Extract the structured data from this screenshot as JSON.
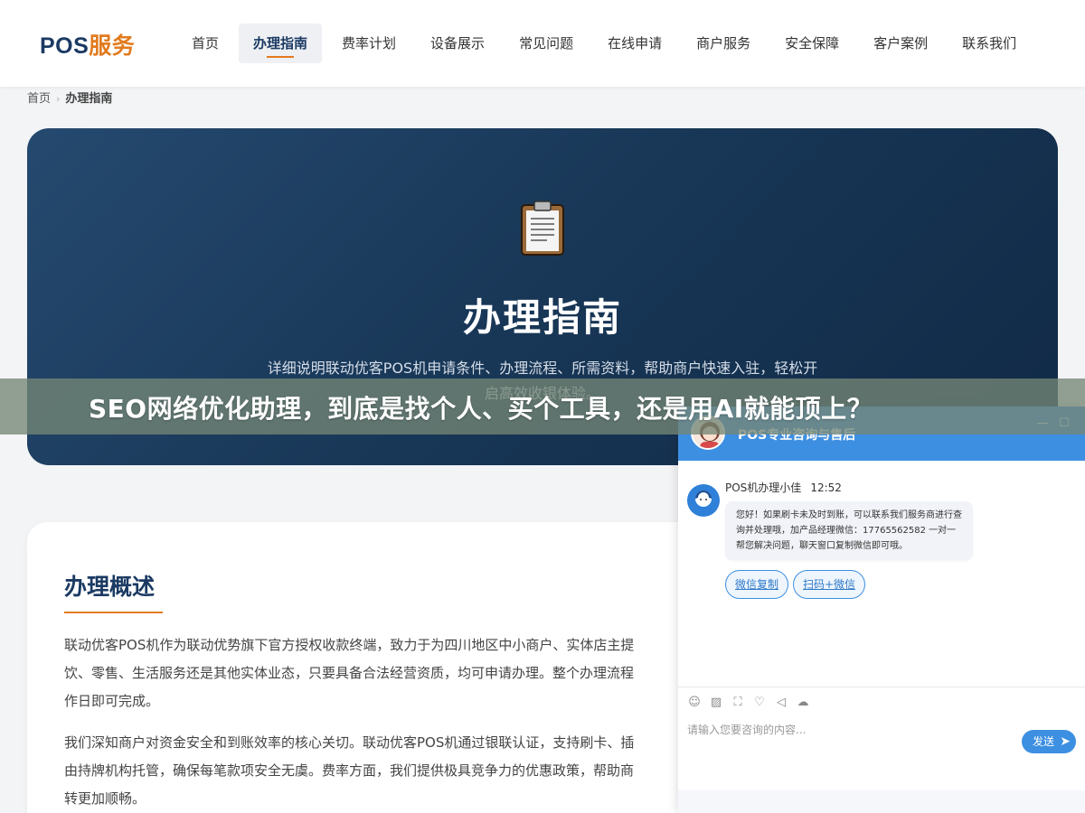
{
  "header": {
    "logo_part1": "POS",
    "logo_part2": "服务",
    "nav": [
      {
        "label": "首页",
        "active": false
      },
      {
        "label": "办理指南",
        "active": true
      },
      {
        "label": "费率计划",
        "active": false
      },
      {
        "label": "设备展示",
        "active": false
      },
      {
        "label": "常见问题",
        "active": false
      },
      {
        "label": "在线申请",
        "active": false
      },
      {
        "label": "商户服务",
        "active": false
      },
      {
        "label": "安全保障",
        "active": false
      },
      {
        "label": "客户案例",
        "active": false
      },
      {
        "label": "联系我们",
        "active": false
      }
    ]
  },
  "breadcrumb": {
    "home": "首页",
    "current": "办理指南"
  },
  "hero": {
    "icon": "clipboard-icon",
    "title": "办理指南",
    "description": "详细说明联动优客POS机申请条件、办理流程、所需资料，帮助商户快速入驻，轻松开启高效收银体验。"
  },
  "overlay_banner": {
    "text": "SEO网络优化助理，到底是找个人、买个工具，还是用AI就能顶上？"
  },
  "overview": {
    "heading": "办理概述",
    "paragraph1": "联动优客POS机作为联动优势旗下官方授权收款终端，致力于为四川地区中小商户、实体店主提\n饮、零售、生活服务还是其他实体业态，只要具备合法经营资质，均可申请办理。整个办理流程\n作日即可完成。",
    "paragraph2": "我们深知商户对资金安全和到账效率的核心关切。联动优客POS机通过银联认证，支持刷卡、插\n由持牌机构托管，确保每笔款项安全无虞。费率方面，我们提供极具竞争力的优惠政策，帮助商\n转更加顺畅。"
  },
  "chat": {
    "title": "POS专业咨询与售后",
    "agent_name": "POS机办理小佳",
    "time": "12:52",
    "message": "您好！如果刷卡未及时到账，可以联系我们服务商进行查询并处理哦，加产品经理微信：17765562582 一对一帮您解决问题，聊天窗口复制微信即可哦。",
    "quick_buttons": [
      "微信复制",
      "扫码+微信"
    ],
    "tool_icons": [
      "emoji-icon",
      "image-icon",
      "screenshot-icon",
      "evaluate-icon",
      "voice-icon",
      "wechat-icon"
    ],
    "input_placeholder": "请输入您要咨询的内容...",
    "send_label": "发送",
    "colors": {
      "accent": "#3d8fe2"
    }
  },
  "colors": {
    "brand_navy": "#1b3a63",
    "brand_orange": "#e27b1e"
  }
}
